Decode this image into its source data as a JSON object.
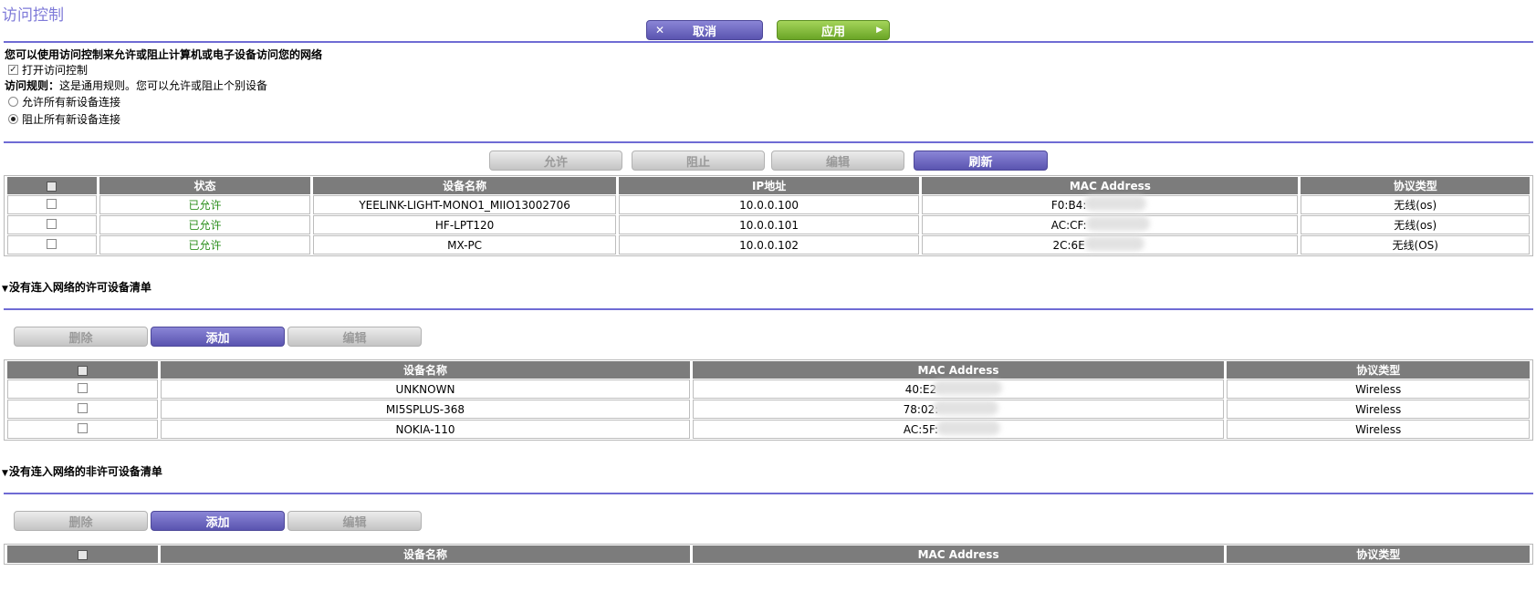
{
  "page": {
    "title": "访问控制"
  },
  "top_buttons": {
    "cancel": "取消",
    "apply": "应用"
  },
  "intro": {
    "description": "您可以使用访问控制来允许或阻止计算机或电子设备访问您的网络",
    "enable_label": "打开访问控制",
    "enable_checked": true,
    "rule_label": "访问规则：",
    "rule_text": "这是通用规则。您可以允许或阻止个别设备",
    "allow_all_label": "允许所有新设备连接",
    "block_all_label": "阻止所有新设备连接",
    "selected_rule": "block"
  },
  "device_toolbar": {
    "allow": "允许",
    "block": "阻止",
    "edit": "编辑",
    "refresh": "刷新"
  },
  "device_table": {
    "headers": [
      "",
      "状态",
      "设备名称",
      "IP地址",
      "MAC Address",
      "协议类型"
    ],
    "rows": [
      {
        "status": "已允许",
        "name": "YEELINK-LIGHT-MONO1_MIIO13002706",
        "ip": "10.0.0.100",
        "mac": "F0:B4:",
        "protocol": "无线(os)"
      },
      {
        "status": "已允许",
        "name": "HF-LPT120",
        "ip": "10.0.0.101",
        "mac": "AC:CF:",
        "protocol": "无线(os)"
      },
      {
        "status": "已允许",
        "name": "MX-PC",
        "ip": "10.0.0.102",
        "mac": "2C:6E",
        "protocol": "无线(OS)"
      }
    ]
  },
  "allowed_section": {
    "title": "没有连入网络的许可设备清单",
    "toolbar": {
      "delete": "删除",
      "add": "添加",
      "edit": "编辑"
    },
    "headers": [
      "",
      "设备名称",
      "MAC Address",
      "协议类型"
    ],
    "rows": [
      {
        "name": "UNKNOWN",
        "mac": "40:E2",
        "protocol": "Wireless"
      },
      {
        "name": "MI5SPLUS-368",
        "mac": "78:02:",
        "protocol": "Wireless"
      },
      {
        "name": "NOKIA-110",
        "mac": "AC:5F:",
        "protocol": "Wireless"
      }
    ]
  },
  "blocked_section": {
    "title": "没有连入网络的非许可设备清单",
    "toolbar": {
      "delete": "删除",
      "add": "添加",
      "edit": "编辑"
    },
    "headers": [
      "",
      "设备名称",
      "MAC Address",
      "协议类型"
    ]
  },
  "colors": {
    "accent": "#6f6bd4",
    "apply_green": "#7ab83c",
    "allowed_text": "#2d8f1e",
    "header_gray": "#7c7c7c"
  }
}
